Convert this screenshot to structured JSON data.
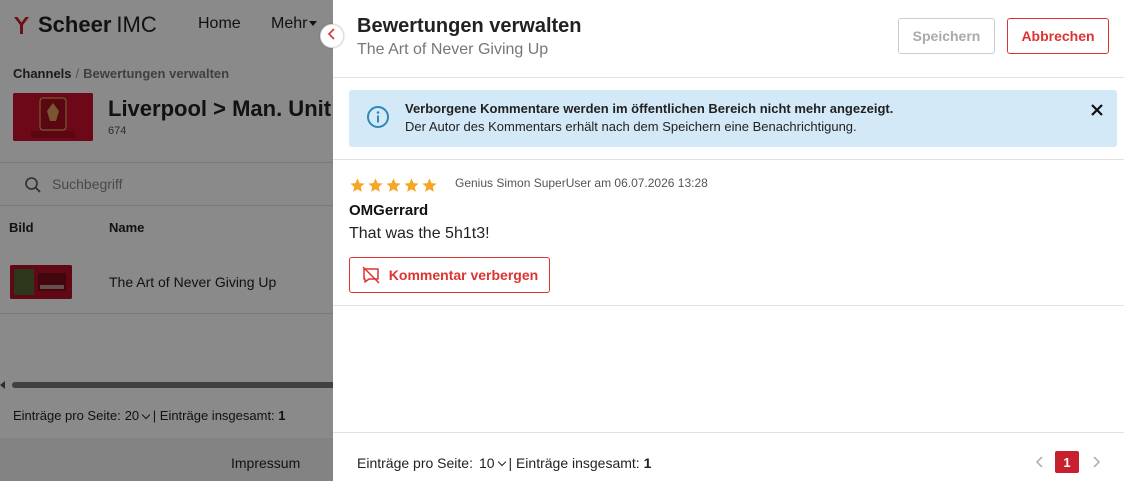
{
  "app": {
    "logo_bold": "Scheer",
    "logo_rest": "IMC",
    "brand_color": "#c8202e"
  },
  "nav": {
    "home": "Home",
    "more": "Mehr"
  },
  "breadcrumb": {
    "first": "Channels",
    "current": "Bewertungen verwalten"
  },
  "channel": {
    "title": "Liverpool > Man. Unit",
    "id": "674"
  },
  "search": {
    "placeholder": "Suchbegriff"
  },
  "table": {
    "headers": {
      "image": "Bild",
      "name": "Name"
    },
    "rows": [
      {
        "name": "The Art of Never Giving Up"
      }
    ]
  },
  "bg_pager": {
    "per_page_label": "Einträge pro Seite:",
    "per_page": "20",
    "total_label": "| Einträge insgesamt:",
    "total": "1"
  },
  "footer": {
    "impressum": "Impressum"
  },
  "drawer": {
    "title": "Bewertungen verwalten",
    "subtitle": "The Art of Never Giving Up",
    "save_label": "Speichern",
    "cancel_label": "Abbrechen",
    "info": {
      "line1": "Verborgene Kommentare werden im öffentlichen Bereich nicht mehr angezeigt.",
      "line2": "Der Autor des Kommentars erhält nach dem Speichern eine Benachrichtigung."
    },
    "review": {
      "rating": 5,
      "meta": "Genius Simon SuperUser am 06.07.2026 13:28",
      "author": "OMGerrard",
      "text": "That was the 5h1t3!",
      "hide_label": "Kommentar verbergen"
    },
    "pager": {
      "per_page_label": "Einträge pro Seite:",
      "per_page": "10",
      "total_label": "| Einträge insgesamt:",
      "total": "1",
      "current_page": "1"
    }
  }
}
